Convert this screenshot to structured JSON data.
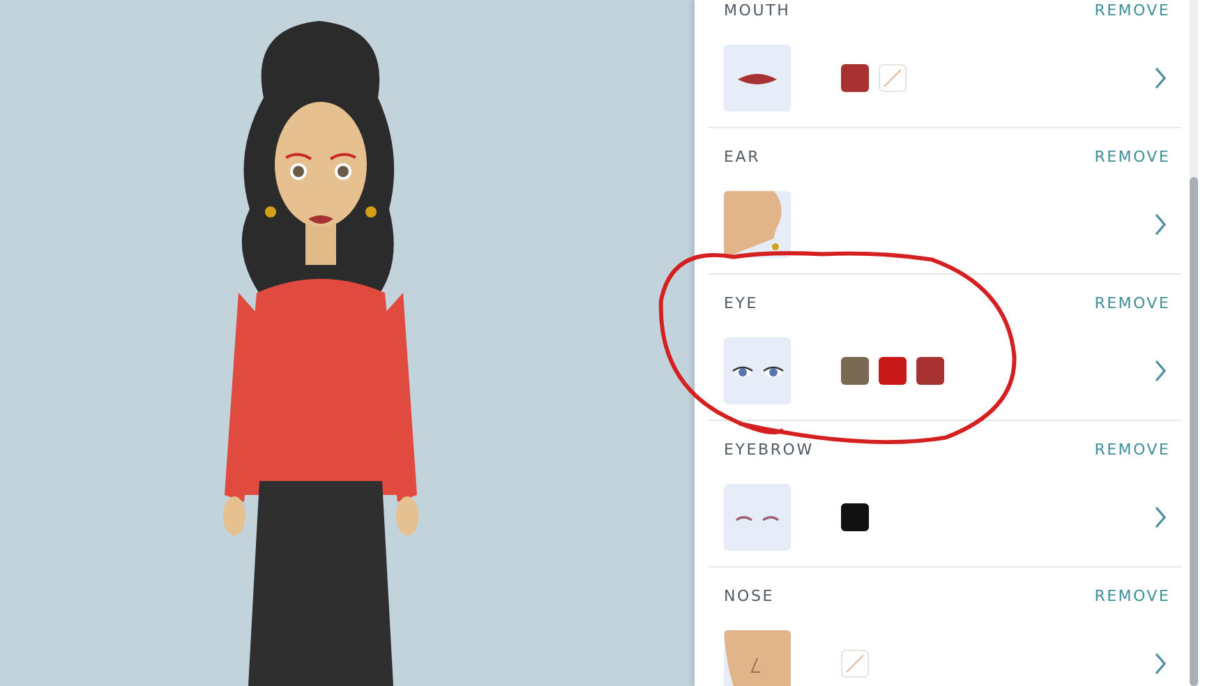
{
  "parts": [
    {
      "kind": "mouth",
      "label": "MOUTH",
      "action": "REMOVE",
      "swatches": [
        {
          "kind": "color",
          "color": "#a83232"
        },
        {
          "kind": "none"
        }
      ]
    },
    {
      "kind": "ear",
      "label": "EAR",
      "action": "REMOVE"
    },
    {
      "kind": "eye",
      "label": "EYE",
      "action": "REMOVE",
      "swatches": [
        {
          "kind": "color",
          "color": "#7a6a55"
        },
        {
          "kind": "color",
          "color": "#c81818"
        },
        {
          "kind": "color",
          "color": "#a83232"
        }
      ]
    },
    {
      "kind": "eyebrow",
      "label": "EYEBROW",
      "action": "REMOVE",
      "swatches": [
        {
          "kind": "color",
          "color": "#111111"
        }
      ]
    },
    {
      "kind": "nose",
      "label": "NOSE",
      "action": "REMOVE",
      "swatches": [
        {
          "kind": "none"
        }
      ]
    }
  ]
}
